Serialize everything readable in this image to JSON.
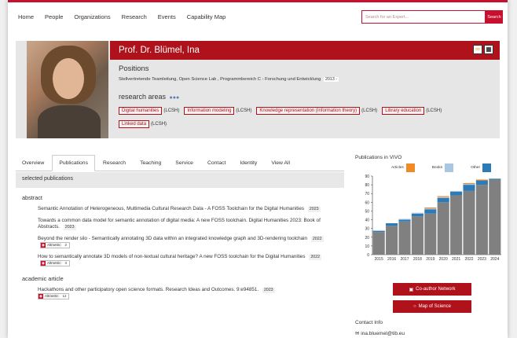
{
  "nav": {
    "items": [
      "Home",
      "People",
      "Organizations",
      "Research",
      "Events",
      "Capability Map"
    ],
    "search_placeholder": "Search for an Expert...",
    "search_button": "Search"
  },
  "profile": {
    "name": "Prof. Dr. Blümel, Ina",
    "positions_heading": "Positions",
    "positions_text": "Stellvertretende Teamleitung, Open Science Lab , Programmbereich C - Forschung und Entwicklung",
    "positions_year": "2013 -",
    "research_areas_heading": "research areas",
    "research_areas": [
      {
        "label": "Digital humanities",
        "suffix": "(LCSH)"
      },
      {
        "label": "Information modeling",
        "suffix": "(LCSH)"
      },
      {
        "label": "Knowledge representation (Information theory)",
        "suffix": "(LCSH)"
      },
      {
        "label": "Library education",
        "suffix": "(LCSH)"
      },
      {
        "label": "Linked data",
        "suffix": "(LCSH)"
      }
    ]
  },
  "tabs": [
    "Overview",
    "Publications",
    "Research",
    "Teaching",
    "Service",
    "Contact",
    "Identity",
    "View All"
  ],
  "active_tab": "Publications",
  "selected_publications_heading": "selected publications",
  "publications": {
    "abstract_heading": "abstract",
    "abstract": [
      {
        "title": "Semantic Annotation of Heterogeneous, Multimedia Cultural Research Data - A FOSS Toolchain for the Digital Humanities",
        "year": "2023"
      },
      {
        "title": "Towards a common data model for semantic annotation of digital media: A new FOSS toolchain. Digital Humanities 2023: Book of Abstracts.",
        "year": "2023"
      },
      {
        "title": "Beyond the render silo - Semantically annotating 3D data within an integrated knowledge graph and 3D-rendering toolchain",
        "year": "2022",
        "altmetric": "2"
      },
      {
        "title": "How to semantically annotate 3D models of non-textual cultural heritage? A new FOSS toolchain for the Digital Humanities",
        "year": "2022",
        "altmetric": "3"
      }
    ],
    "article_heading": "academic article",
    "article": [
      {
        "title": "Hackathons and other participatory open science formats. Research Ideas and Outcomes. 9:e94851.",
        "year": "2023",
        "altmetric": "12"
      }
    ],
    "altmetric_label": "Altmetric"
  },
  "chart_data": {
    "type": "bar",
    "title": "Publications in VIVO",
    "categories": [
      "2015",
      "2016",
      "2017",
      "2018",
      "2019",
      "2020",
      "2021",
      "2022",
      "2023",
      "2024"
    ],
    "series": [
      {
        "name": "Articles",
        "color": "#f08a24",
        "values": [
          0,
          0,
          0,
          0,
          1,
          1,
          0,
          1,
          1,
          0
        ]
      },
      {
        "name": "Books",
        "color": "#a9c6e3",
        "values": [
          1,
          0,
          1,
          1,
          1,
          1,
          1,
          1,
          0,
          0
        ]
      },
      {
        "name": "Other",
        "color": "#2c7bb6",
        "values": [
          1,
          3,
          2,
          3,
          5,
          5,
          4,
          7,
          5,
          1
        ]
      }
    ],
    "base_values": [
      26,
      33,
      38,
      44,
      47,
      60,
      68,
      73,
      80,
      86
    ],
    "ylim": [
      0,
      90
    ],
    "yticks": [
      0,
      10,
      20,
      30,
      40,
      50,
      60,
      70,
      80,
      90
    ],
    "base_color": "#808080"
  },
  "coauthor_button": "Co-author Network",
  "map_button": "Map of Science",
  "contact": {
    "heading": "Contact Info",
    "email": "ina.bluemel@tib.eu"
  }
}
